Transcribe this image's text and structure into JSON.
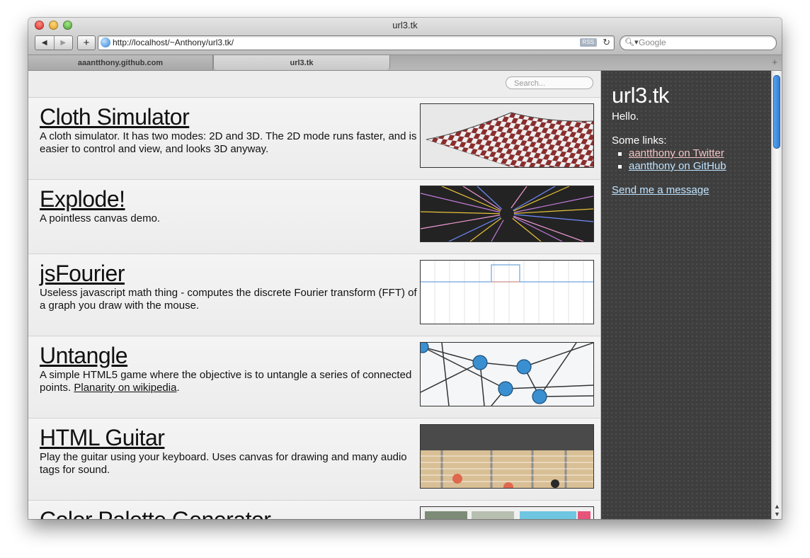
{
  "window": {
    "title": "url3.tk",
    "url": "http://localhost/~Anthony/url3.tk/",
    "rss_label": "RSS",
    "search_placeholder": "Google"
  },
  "tabs": [
    {
      "label": "aaantthony.github.com"
    },
    {
      "label": "url3.tk"
    }
  ],
  "main": {
    "search_placeholder": "Search..."
  },
  "projects": [
    {
      "title": "Cloth Simulator",
      "description": "A cloth simulator. It has two modes: 2D and 3D. The 2D mode runs faster, and is easier to control and view, and looks 3D anyway."
    },
    {
      "title": "Explode!",
      "description": "A pointless canvas demo."
    },
    {
      "title": "jsFourier",
      "description": "Useless javascript math thing - computes the discrete Fourier transform (FFT) of a graph you draw with the mouse."
    },
    {
      "title": "Untangle",
      "description": "A simple HTML5 game where the objective is to untangle a series of connected points. ",
      "link": "Planarity on wikipedia",
      "after": "."
    },
    {
      "title": "HTML Guitar",
      "description": "Play the guitar using your keyboard. Uses canvas for drawing and many audio tags for sound."
    },
    {
      "title": "Color Palette Generator",
      "description": ""
    }
  ],
  "sidebar": {
    "title": "url3.tk",
    "hello": "Hello.",
    "links_heading": "Some links:",
    "links": [
      {
        "label": "aantthony on Twitter"
      },
      {
        "label": "aantthony on GitHub"
      }
    ],
    "send_message": "Send me a message"
  }
}
